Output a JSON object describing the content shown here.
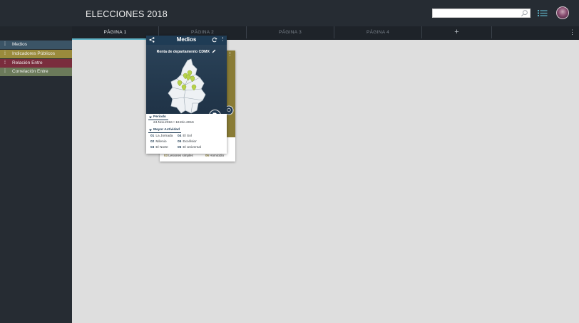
{
  "app": {
    "title": "ELECCIONES 2018"
  },
  "search": {
    "value": "",
    "placeholder": ""
  },
  "tabs": [
    {
      "label": "PÁGINA 1",
      "active": true
    },
    {
      "label": "PÁGINA 2",
      "active": false
    },
    {
      "label": "PÁGINA 3",
      "active": false
    },
    {
      "label": "PÁGINA 4",
      "active": false
    }
  ],
  "tab_add": "+",
  "tab_more": "⋮",
  "sidebar": {
    "items": [
      {
        "label": "Medios",
        "color": "#3b5466"
      },
      {
        "label": "Indicadores Públicos",
        "color": "#9a8b3c"
      },
      {
        "label": "Relación Entre",
        "color": "#7a2d3d"
      },
      {
        "label": "Correlación Entre",
        "color": "#6b7a5a"
      }
    ],
    "dots": "⁞"
  },
  "card": {
    "title": "Medios",
    "subtitle": "Renta de departamento CDMX",
    "periodo_label": "Periodo",
    "periodo_value": "24.Nov.2016 • 18.Dic.2016",
    "actividad_label": "Mayor Actividad",
    "media": [
      {
        "num": "01",
        "name": "La Jornada"
      },
      {
        "num": "04",
        "name": "El Sol"
      },
      {
        "num": "02",
        "name": "Milenio"
      },
      {
        "num": "05",
        "name": "Excélsior"
      },
      {
        "num": "03",
        "name": "El Norte"
      },
      {
        "num": "06",
        "name": "El Universal"
      }
    ]
  },
  "card_back": {
    "row_left_num": "03",
    "row_left": "Lesiones simples",
    "row_right_num": "06",
    "row_right": "Homicidio"
  },
  "colors": {
    "topbar": "#262c33",
    "sidebar": "#262c33",
    "canvas": "#dedede",
    "accent": "#5fb2c6",
    "card_header": "#1f3c55",
    "pin": "#b7d24a"
  },
  "icons": {
    "search": "search-icon",
    "list": "list-icon",
    "share": "share-icon",
    "refresh": "refresh-icon",
    "edit": "pencil-icon",
    "document": "document-icon",
    "chevron": "caret-down-icon"
  }
}
